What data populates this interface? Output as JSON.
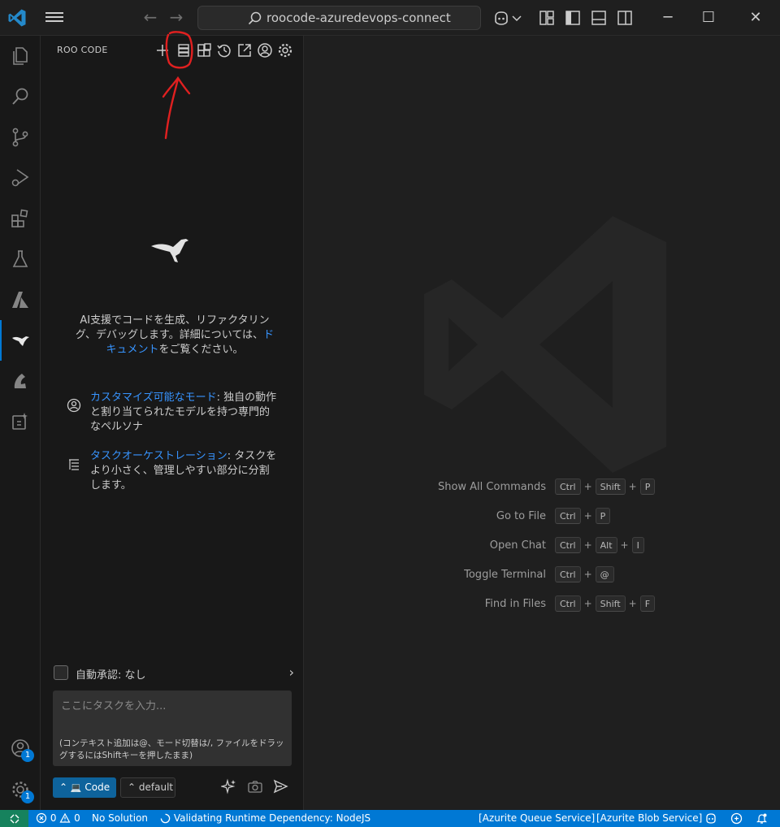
{
  "titlebar": {
    "search_text": "roocode-azuredevops-connect",
    "window_controls": {
      "minimize": "─",
      "maximize": "☐",
      "close": "✕"
    }
  },
  "activity_bar": {
    "items": [
      "explorer-icon",
      "search-icon",
      "source-control-icon",
      "run-debug-icon",
      "extensions-icon",
      "testing-icon",
      "azure-icon",
      "roo-code-icon",
      "bicep-icon",
      "remote-icon"
    ],
    "accounts_badge": "1",
    "settings_badge": "1"
  },
  "sidebar": {
    "title": "ROO CODE",
    "intro_text": "AI支援でコードを生成、リファクタリング、デバッグします。詳細については、",
    "intro_link": "ドキュメント",
    "intro_suffix": "をご覧ください。",
    "features": [
      {
        "link": "カスタマイズ可能なモード",
        "text": ": 独自の動作と割り当てられたモデルを持つ専門的なペルソナ"
      },
      {
        "link": "タスクオーケストレーション",
        "text": ": タスクをより小さく、管理しやすい部分に分割します。"
      }
    ],
    "auto_approve_label": "自動承認: なし",
    "task_input": {
      "placeholder": "ここにタスクを入力...",
      "hint": "(コンテキスト追加は@、モード切替は/, ファイルをドラッグするにはShiftキーを押したまま)"
    },
    "mode_button": "Code",
    "config_button": "default"
  },
  "editor": {
    "shortcuts": [
      {
        "label": "Show All Commands",
        "keys": [
          "Ctrl",
          "Shift",
          "P"
        ]
      },
      {
        "label": "Go to File",
        "keys": [
          "Ctrl",
          "P"
        ]
      },
      {
        "label": "Open Chat",
        "keys": [
          "Ctrl",
          "Alt",
          "I"
        ]
      },
      {
        "label": "Toggle Terminal",
        "keys": [
          "Ctrl",
          "@"
        ]
      },
      {
        "label": "Find in Files",
        "keys": [
          "Ctrl",
          "Shift",
          "F"
        ]
      }
    ]
  },
  "statusbar": {
    "errors": "0",
    "warnings": "0",
    "solution": "No Solution",
    "task": "Validating Runtime Dependency: NodeJS",
    "queue": "[Azurite Queue Service]",
    "blob": "[Azurite Blob Service]"
  },
  "colors": {
    "accent": "#0078d4",
    "link": "#3794ff",
    "annotation": "#e02020",
    "remote": "#16825d"
  }
}
